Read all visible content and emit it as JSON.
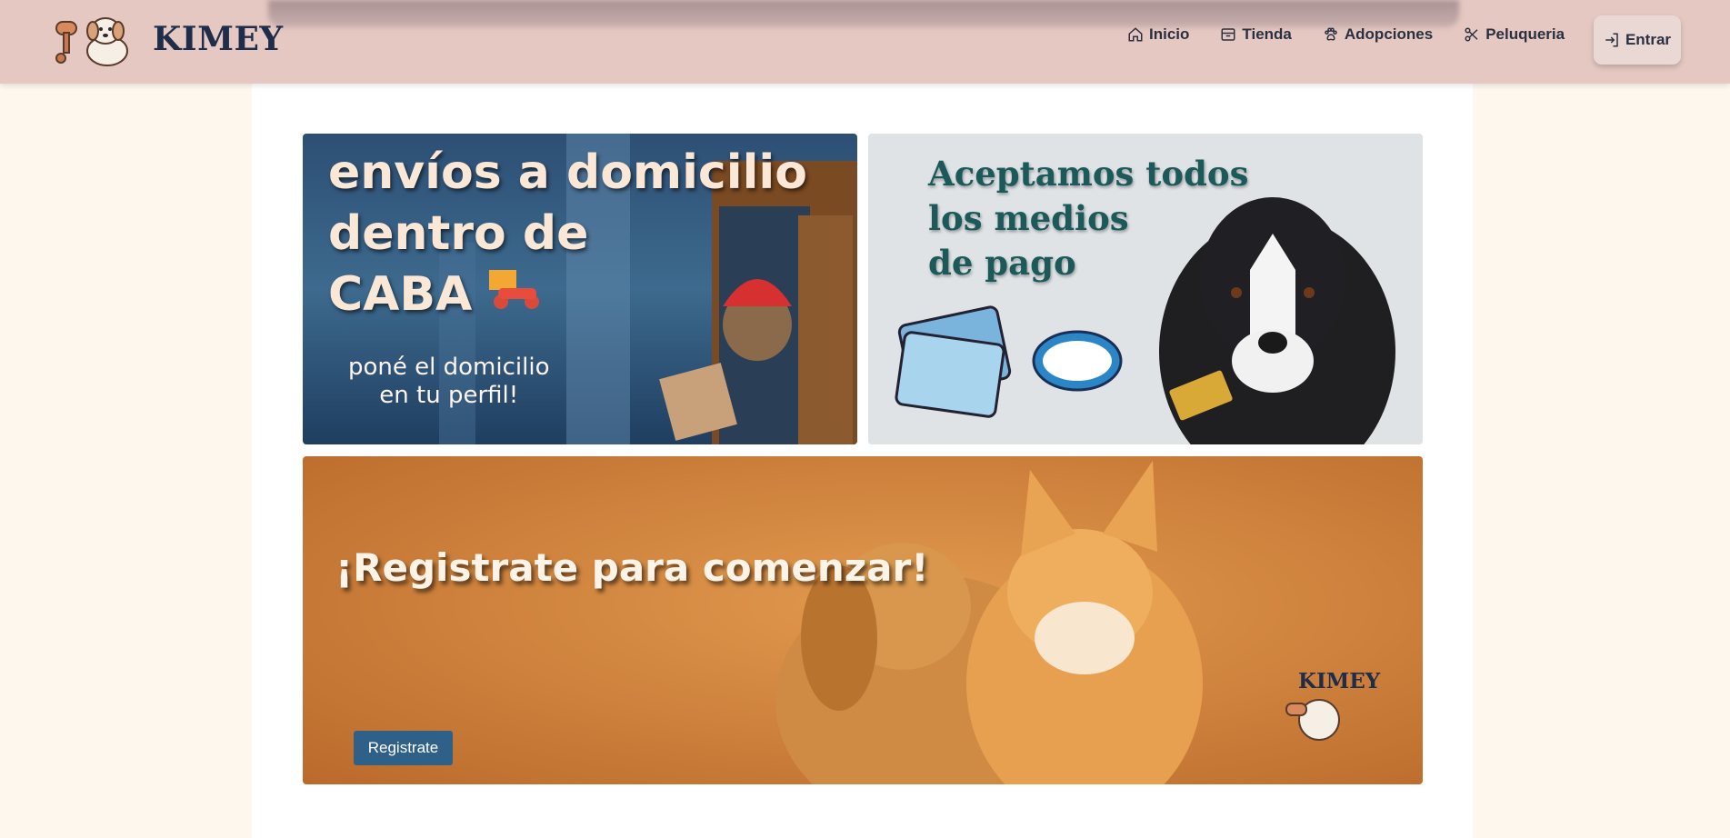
{
  "header": {
    "brand": "KIMEY",
    "nav": [
      {
        "label": "Inicio",
        "icon": "home-icon"
      },
      {
        "label": "Tienda",
        "icon": "store-icon"
      },
      {
        "label": "Adopciones",
        "icon": "paw-icon"
      },
      {
        "label": "Peluqueria",
        "icon": "scissors-icon"
      }
    ],
    "login_label": "Entrar"
  },
  "banners": {
    "delivery": {
      "headline_1": "envíos a domicilio",
      "headline_2": "dentro de",
      "headline_3": "CABA",
      "sub_1": "poné el domicilio",
      "sub_2": "en tu perfil!"
    },
    "payments": {
      "headline_1": "Aceptamos todos",
      "headline_2": "los medios",
      "headline_3": "de pago"
    },
    "register": {
      "headline": "¡Registrate para comenzar!",
      "button_label": "Registrate",
      "watermark": "KIMEY"
    }
  },
  "colors": {
    "header_bg": "#e4c8c1",
    "page_bg": "#fdf7ee",
    "brand_text": "#1f2d4a",
    "button_blue": "#2f6088"
  }
}
